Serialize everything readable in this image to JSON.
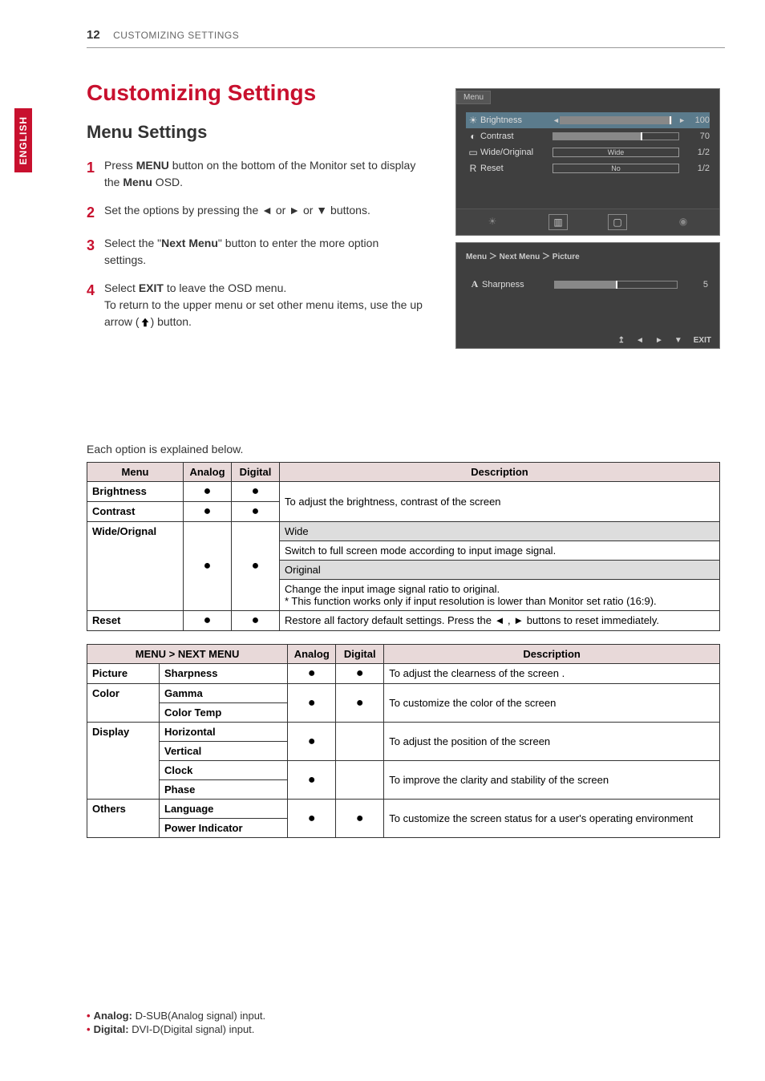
{
  "page": {
    "number": "12",
    "header_title": "CUSTOMIZING SETTINGS",
    "side_tab": "ENGLISH"
  },
  "h1": "Customizing Settings",
  "h2": "Menu Settings",
  "steps": {
    "s1": {
      "num": "1",
      "pre": "Press ",
      "b1": "MENU",
      "mid": " button on the bottom of the Monitor set to display the ",
      "b2": "Menu",
      "post": " OSD."
    },
    "s2": {
      "num": "2",
      "text": "Set the options by pressing the ◄ or ► or ▼ buttons."
    },
    "s3": {
      "num": "3",
      "pre": "Select the \"",
      "b1": "Next Menu",
      "post": "\" button to enter the more option settings."
    },
    "s4": {
      "num": "4",
      "pre": "Select ",
      "b1": "EXIT",
      "mid": " to leave the OSD menu.",
      "line2_pre": "To return to the upper menu or set other menu items, use the up arrow (",
      "line2_post": ") button."
    }
  },
  "osd1": {
    "tab": "Menu",
    "rows": [
      {
        "icon": "☀",
        "label": "Brightness",
        "val": "100",
        "fill": 100
      },
      {
        "icon": "◐",
        "label": "Contrast",
        "val": "70",
        "fill": 70
      },
      {
        "icon": "▭",
        "label": "Wide/Original",
        "sel": "Wide",
        "val": "1/2"
      },
      {
        "icon": "R",
        "label": "Reset",
        "sel": "No",
        "val": "1/2"
      }
    ],
    "tabicons": [
      "☀",
      "▥",
      "▢",
      "◉"
    ]
  },
  "osd2": {
    "breadcrumb": "Menu  ＞  Next Menu  ＞  Picture",
    "row": {
      "icon": "A",
      "label": "Sharpness",
      "val": "5",
      "fill": 50
    },
    "footer": [
      "↥",
      "◄",
      "►",
      "▼",
      "EXIT"
    ]
  },
  "intro": "Each option is explained below.",
  "table1": {
    "headers": {
      "menu": "Menu",
      "analog": "Analog",
      "digital": "Digital",
      "desc": "Description"
    },
    "rows": {
      "brightness": "Brightness",
      "contrast": "Contrast",
      "bc_desc": "To adjust the brightness, contrast of the screen",
      "wo": "Wide/Orignal",
      "wide_h": "Wide",
      "wide_d": "Switch to full screen mode according to input image signal.",
      "orig_h": "Original",
      "orig_d": "Change the input image signal ratio to original.\n* This function works only if input resolution is lower than Monitor set ratio (16:9).",
      "reset": "Reset",
      "reset_d": "Restore all factory default settings. Press the ◄ , ►    buttons to reset immediately."
    }
  },
  "table2": {
    "headers": {
      "menu": "MENU > NEXT MENU",
      "analog": "Analog",
      "digital": "Digital",
      "desc": "Description"
    },
    "rows": {
      "picture": "Picture",
      "sharpness": "Sharpness",
      "sharp_d": "To adjust the clearness of the screen .",
      "color": "Color",
      "gamma": "Gamma",
      "colortemp": "Color Temp",
      "color_d": "To customize the color of the screen",
      "display": "Display",
      "horizontal": "Horizontal",
      "vertical": "Vertical",
      "disp_d": "To adjust the position of the screen",
      "clock": "Clock",
      "phase": "Phase",
      "clock_d": "To improve the clarity and stability of the screen",
      "others": "Others",
      "language": "Language",
      "powerind": "Power Indicator",
      "others_d": "To customize the screen status for a user's operating environment"
    }
  },
  "footnotes": {
    "analog": {
      "label": "Analog:",
      "text": " D-SUB(Analog signal) input."
    },
    "digital": {
      "label": "Digital:",
      "text": " DVI-D(Digital signal) input."
    }
  }
}
